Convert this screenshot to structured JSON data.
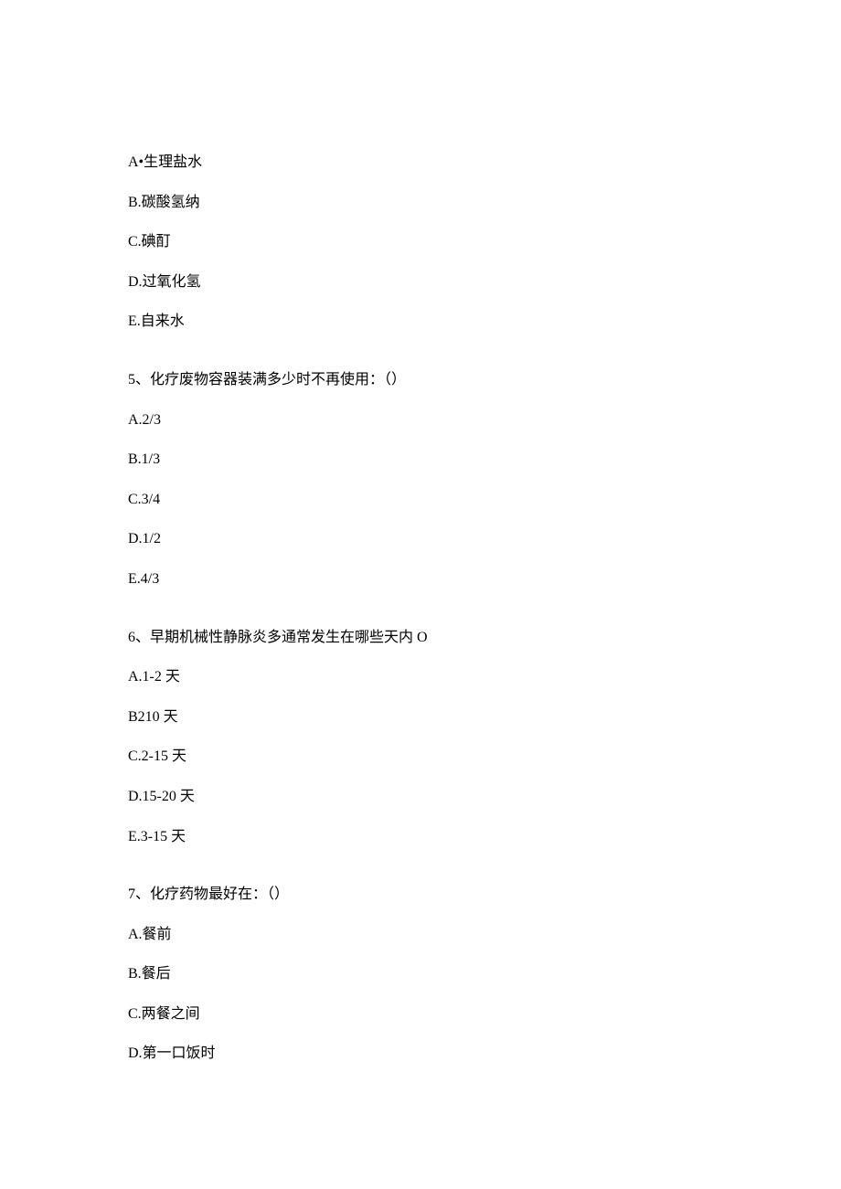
{
  "q4_options": {
    "a": "A•生理盐水",
    "b": "B.碳酸氢纳",
    "c": "C.碘酊",
    "d": "D.过氧化氢",
    "e": "E.自来水"
  },
  "q5": {
    "question": "5、化疗废物容器装满多少时不再使用：（）",
    "options": {
      "a": "A.2/3",
      "b": "B.1/3",
      "c": "C.3/4",
      "d": "D.1/2",
      "e": "E.4/3"
    }
  },
  "q6": {
    "question": "6、早期机械性静脉炎多通常发生在哪些天内 O",
    "options": {
      "a": "A.1-2 天",
      "b": "B210 天",
      "c": "C.2-15 天",
      "d": "D.15-20 天",
      "e": "E.3-15 天"
    }
  },
  "q7": {
    "question": "7、化疗药物最好在：（）",
    "options": {
      "a": "A.餐前",
      "b": "B.餐后",
      "c": "C.两餐之间",
      "d": "D.第一口饭时"
    }
  }
}
